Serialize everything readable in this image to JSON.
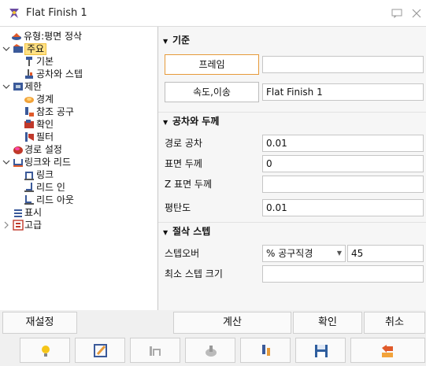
{
  "window": {
    "title": "Flat Finish 1"
  },
  "tree": [
    {
      "label": "유형:평면 정삭",
      "icon": "op-type-icon"
    },
    {
      "label": "주요",
      "icon": "main-icon",
      "selected": true,
      "expanded": true
    },
    {
      "label": "기본",
      "icon": "tool-icon"
    },
    {
      "label": "공차와 스텝",
      "icon": "tolerance-icon"
    },
    {
      "label": "제한",
      "icon": "limit-icon",
      "expanded": true
    },
    {
      "label": "경계",
      "icon": "boundary-icon"
    },
    {
      "label": "참조 공구",
      "icon": "reference-tool-icon"
    },
    {
      "label": "확인",
      "icon": "check-icon"
    },
    {
      "label": "필터",
      "icon": "filter-icon"
    },
    {
      "label": "경로 설정",
      "icon": "path-settings-icon"
    },
    {
      "label": "링크와 리드",
      "icon": "links-leads-icon",
      "expanded": true
    },
    {
      "label": "링크",
      "icon": "link-icon"
    },
    {
      "label": "리드 인",
      "icon": "lead-in-icon"
    },
    {
      "label": "리드 아웃",
      "icon": "lead-out-icon"
    },
    {
      "label": "표시",
      "icon": "display-icon"
    },
    {
      "label": "고급",
      "icon": "advanced-icon",
      "collapsed": true
    }
  ],
  "props": {
    "basis": {
      "header": "기준",
      "frame_button": "프레임",
      "frame_value": "",
      "feeds_button": "속도,이송",
      "feeds_value": "Flat Finish 1"
    },
    "tolerance": {
      "header": "공차와 두께",
      "path_tol_label": "경로 공차",
      "path_tol_value": "0.01",
      "stock_label": "표면 두께",
      "stock_value": "0",
      "z_stock_label": "Z 표면 두께",
      "z_stock_value": "",
      "flatness_label": "평탄도",
      "flatness_value": "0.01"
    },
    "stepover": {
      "header": "절삭 스텝",
      "stepover_label": "스텝오버",
      "stepover_mode": "% 공구직경",
      "stepover_value": "45",
      "min_step_label": "최소 스텝 크기",
      "min_step_value": ""
    }
  },
  "actions": {
    "reset": "재설정",
    "calculate": "계산",
    "ok": "확인",
    "cancel": "취소"
  },
  "toolbar_icons": [
    "lightbulb-icon",
    "edit-icon",
    "simulate-icon",
    "preview-icon",
    "tool-library-icon",
    "save-icon",
    "undo-icon"
  ],
  "colors": {
    "accent_orange": "#e69a3a",
    "selection": "#ffe184"
  }
}
